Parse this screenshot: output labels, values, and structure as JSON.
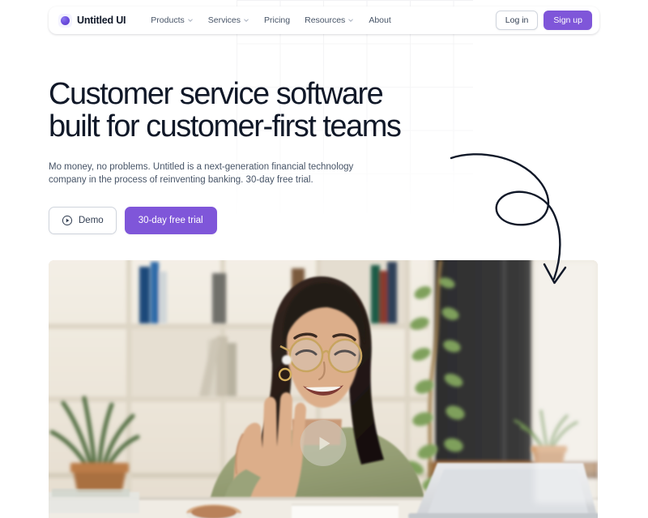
{
  "brand": {
    "name": "Untitled UI",
    "logo_icon": "untitled-ui-circle-logo",
    "accent_color": "#7F56D9"
  },
  "nav": {
    "items": [
      {
        "label": "Products",
        "has_chevron": true,
        "icon": "chevron-down-icon"
      },
      {
        "label": "Services",
        "has_chevron": true,
        "icon": "chevron-down-icon"
      },
      {
        "label": "Pricing",
        "has_chevron": false,
        "icon": ""
      },
      {
        "label": "Resources",
        "has_chevron": true,
        "icon": "chevron-down-icon"
      },
      {
        "label": "About",
        "has_chevron": false,
        "icon": ""
      }
    ],
    "login_label": "Log in",
    "signup_label": "Sign up"
  },
  "hero": {
    "headline": "Customer service software\nbuilt for customer-first teams",
    "subhead": "Mo money, no problems. Untitled is a next-generation financial technology company in the process of reinventing banking. 30-day free trial.",
    "demo_label": "Demo",
    "demo_icon": "play-circle-icon",
    "trial_label": "30-day free trial",
    "doodle_icon": "curved-loop-arrow-icon"
  },
  "media": {
    "play_button_icon": "play-triangle-icon",
    "alt": "Smiling woman with glasses waving at a laptop during a video call in a bright office with bookshelves and plants"
  },
  "colors": {
    "accent": "#7F56D9",
    "heading": "#101828",
    "body_text": "#475467",
    "border": "#D0D5DD",
    "page_bg": "#FFFFFF",
    "grid_line": "#F0F0F2"
  }
}
